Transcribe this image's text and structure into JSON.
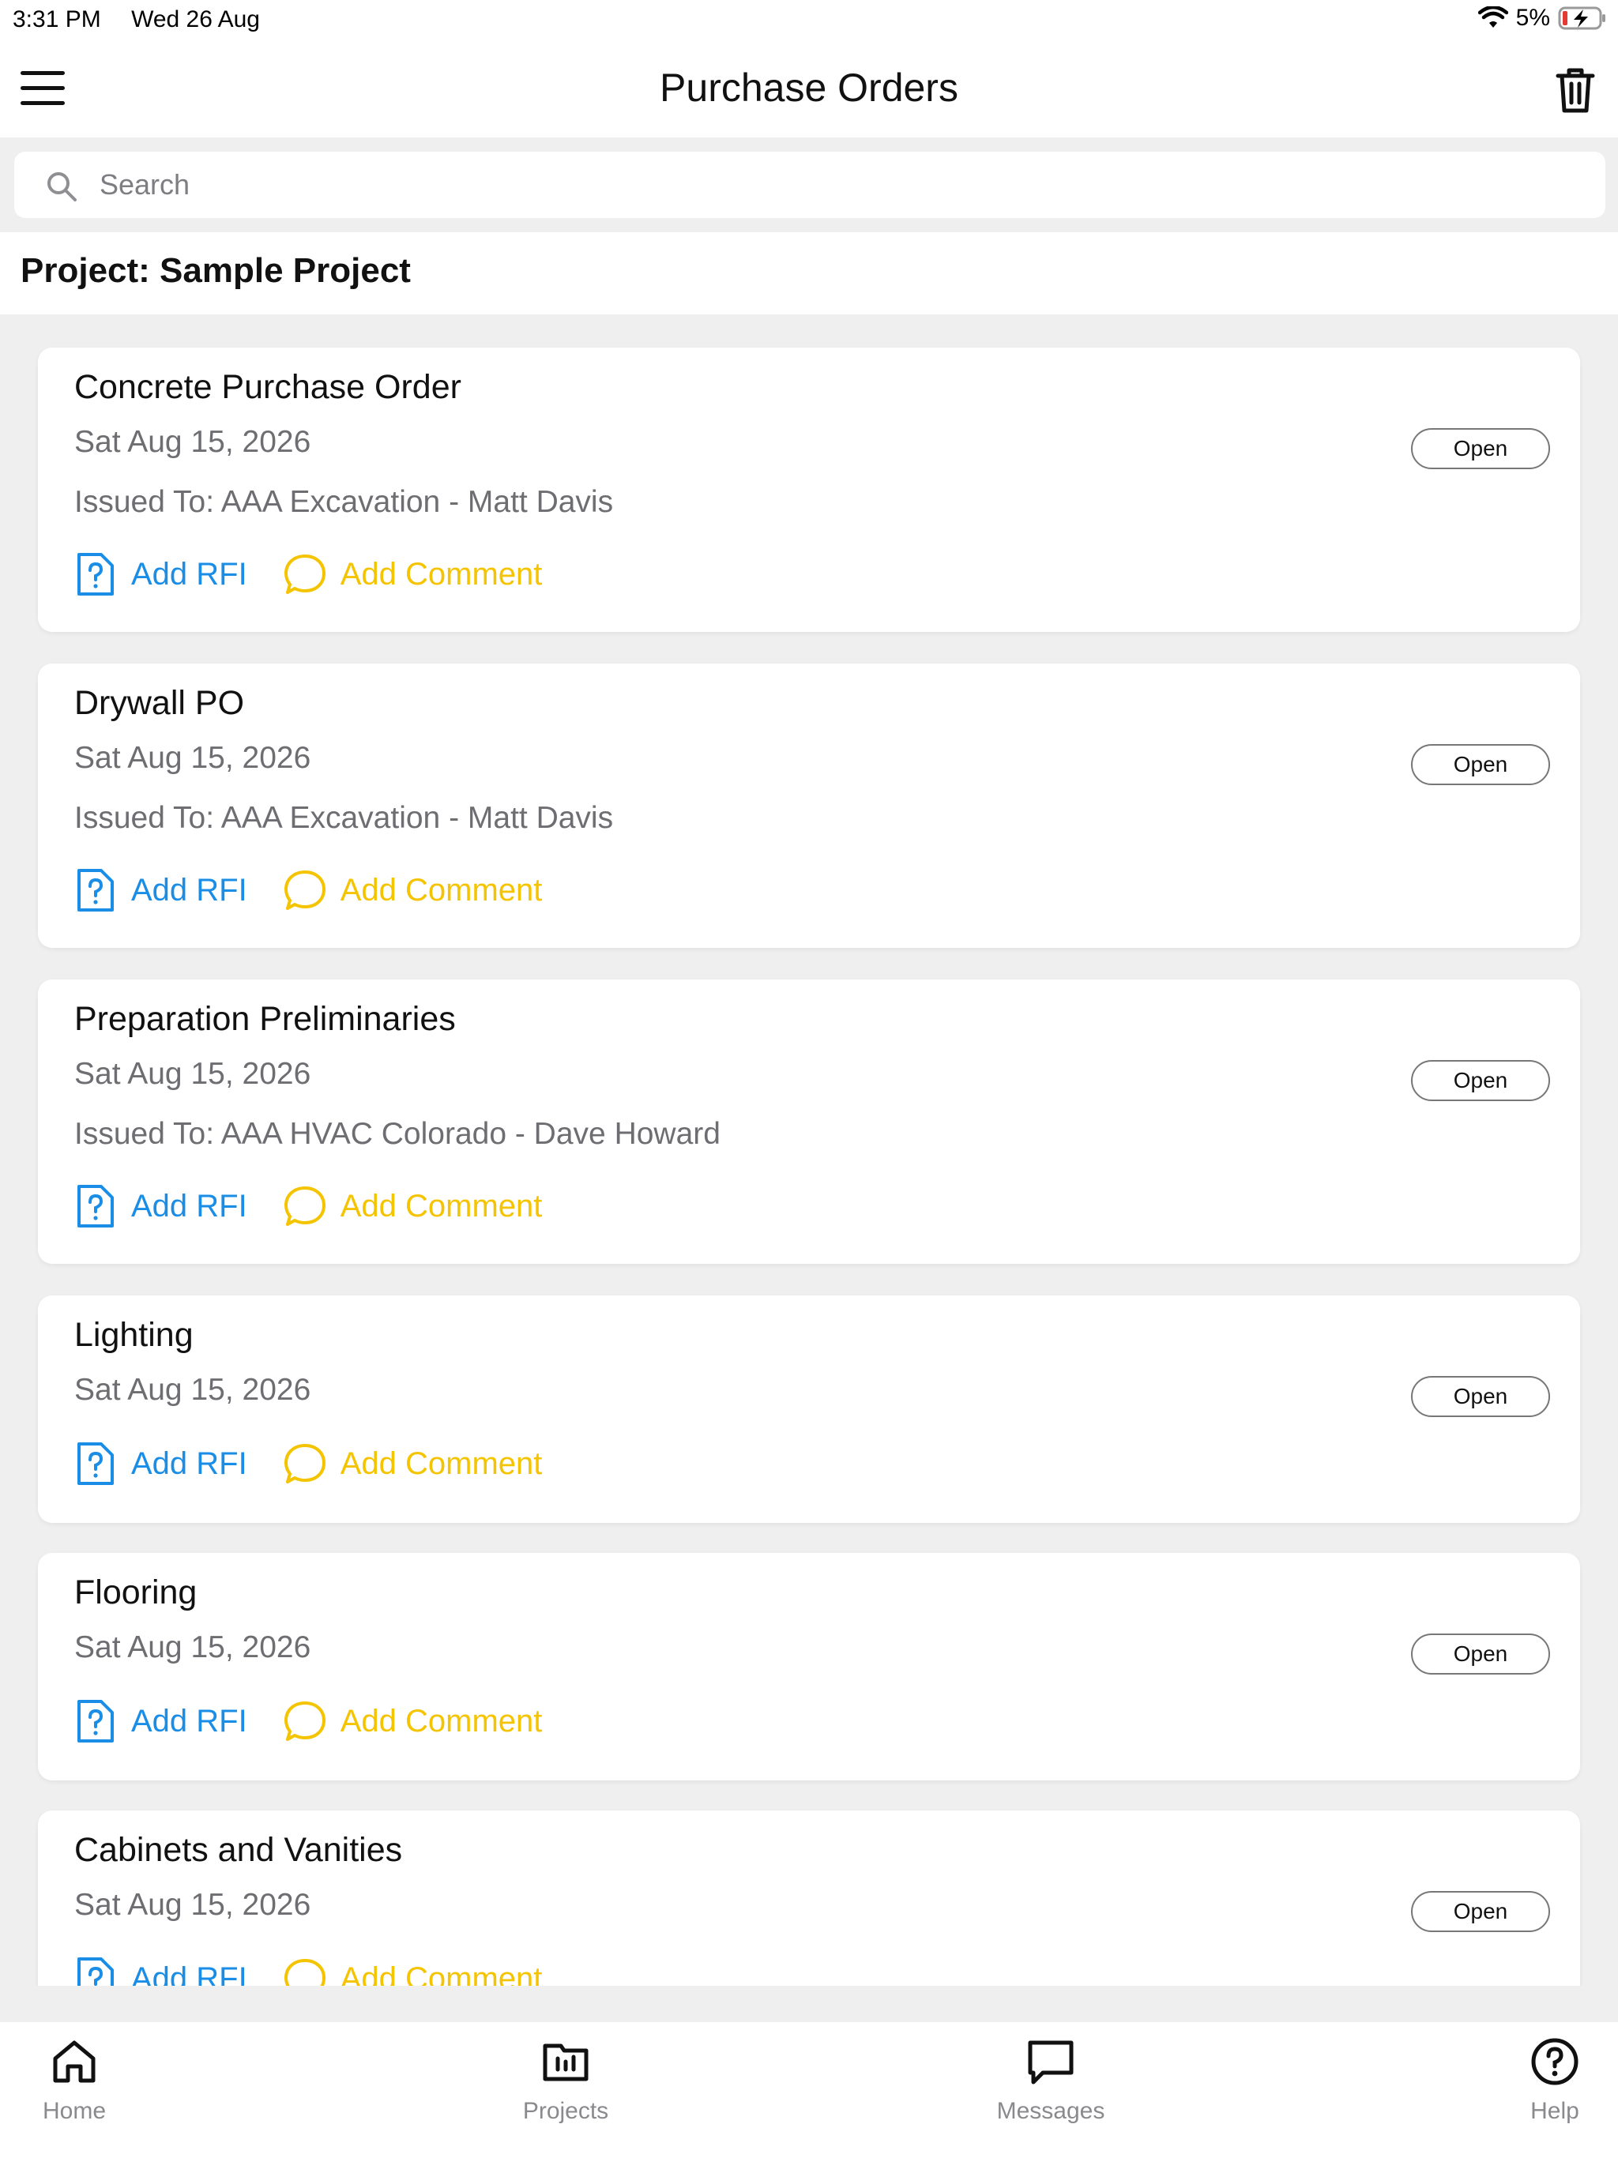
{
  "status_bar": {
    "time": "3:31 PM",
    "date": "Wed 26 Aug",
    "battery": "5%"
  },
  "header": {
    "title": "Purchase Orders"
  },
  "search": {
    "placeholder": "Search"
  },
  "project": {
    "label": "Project: Sample Project"
  },
  "orders": [
    {
      "title": "Concrete Purchase Order",
      "date": "Sat Aug 15, 2026",
      "issued_to": "Issued To: AAA Excavation - Matt Davis",
      "status": "Open"
    },
    {
      "title": "Drywall PO",
      "date": "Sat Aug 15, 2026",
      "issued_to": "Issued To: AAA Excavation - Matt Davis",
      "status": "Open"
    },
    {
      "title": "Preparation Preliminaries",
      "date": "Sat Aug 15, 2026",
      "issued_to": "Issued To: AAA HVAC Colorado - Dave Howard",
      "status": "Open"
    },
    {
      "title": "Lighting",
      "date": "Sat Aug 15, 2026",
      "status": "Open"
    },
    {
      "title": "Flooring",
      "date": "Sat Aug 15, 2026",
      "status": "Open"
    },
    {
      "title": "Cabinets and Vanities",
      "date": "Sat Aug 15, 2026",
      "status": "Open"
    }
  ],
  "actions": {
    "add_rfi": "Add RFI",
    "add_comment": "Add Comment"
  },
  "tabs": [
    {
      "label": "Home",
      "icon": "home-icon"
    },
    {
      "label": "Projects",
      "icon": "projects-icon"
    },
    {
      "label": "Messages",
      "icon": "messages-icon"
    },
    {
      "label": "Help",
      "icon": "help-icon"
    }
  ],
  "colors": {
    "rfi_blue": "#1a8ee6",
    "comment_yellow": "#f5c400",
    "battery_red": "#e53935"
  }
}
